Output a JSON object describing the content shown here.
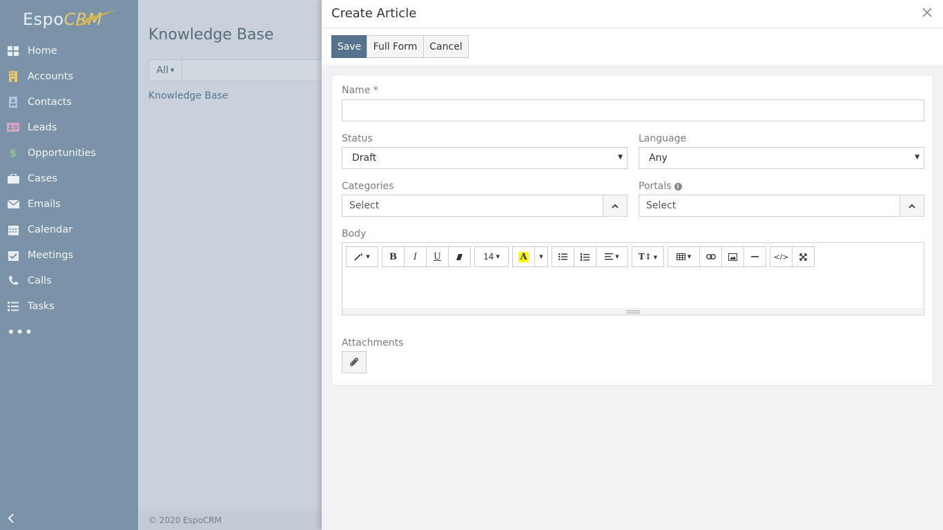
{
  "app": {
    "logo_main": "Espo",
    "logo_accent": "CRM"
  },
  "sidebar": {
    "items": [
      {
        "label": "Home",
        "icon": "home-icon",
        "color": "#e9eef2"
      },
      {
        "label": "Accounts",
        "icon": "building-icon",
        "color": "#e8c96a"
      },
      {
        "label": "Contacts",
        "icon": "contact-icon",
        "color": "#aec5e0"
      },
      {
        "label": "Leads",
        "icon": "id-card-icon",
        "color": "#d8a3c3"
      },
      {
        "label": "Opportunities",
        "icon": "dollar-icon",
        "color": "#8fc38f"
      },
      {
        "label": "Cases",
        "icon": "briefcase-icon",
        "color": "#e9eef2"
      },
      {
        "label": "Emails",
        "icon": "envelope-icon",
        "color": "#e9eef2"
      },
      {
        "label": "Calendar",
        "icon": "calendar-icon",
        "color": "#e9eef2"
      },
      {
        "label": "Meetings",
        "icon": "calendar-check-icon",
        "color": "#e9eef2"
      },
      {
        "label": "Calls",
        "icon": "phone-icon",
        "color": "#e9eef2"
      },
      {
        "label": "Tasks",
        "icon": "tasks-icon",
        "color": "#e9eef2"
      }
    ],
    "more_label": "•••"
  },
  "content": {
    "title": "Knowledge Base",
    "filter_label": "All",
    "link": "Knowledge Base",
    "footer": "© 2020 EspoCRM"
  },
  "modal": {
    "title": "Create Article",
    "buttons": {
      "save": "Save",
      "full_form": "Full Form",
      "cancel": "Cancel"
    },
    "fields": {
      "name_label": "Name *",
      "status_label": "Status",
      "status_value": "Draft",
      "language_label": "Language",
      "language_value": "Any",
      "categories_label": "Categories",
      "categories_placeholder": "Select",
      "portals_label": "Portals",
      "portals_placeholder": "Select",
      "body_label": "Body",
      "attachments_label": "Attachments"
    },
    "editor": {
      "font_size": "14"
    }
  },
  "colors": {
    "sidebar": "#7a93a8",
    "primary_button": "#55738e",
    "highlight": "#ffff00"
  }
}
